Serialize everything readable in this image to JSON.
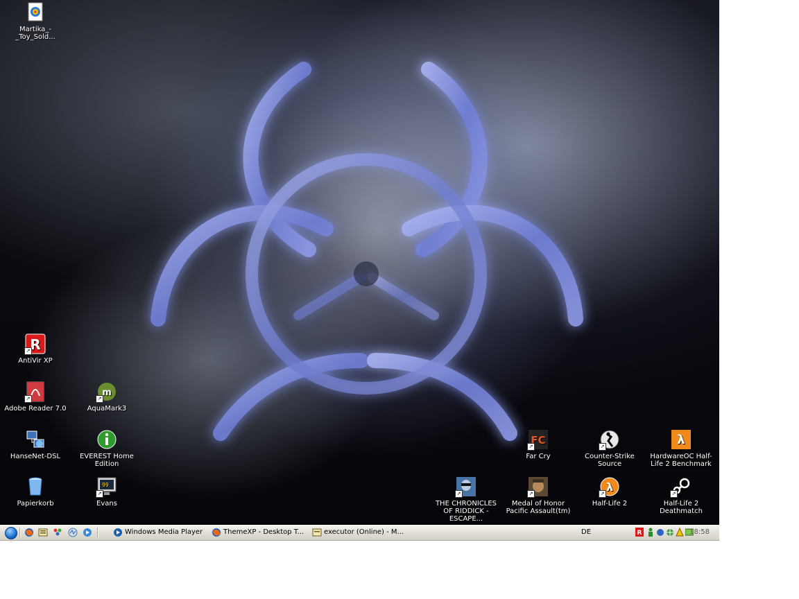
{
  "desktop_icons": [
    {
      "label": "Martika_-_Toy_Sold...",
      "icon": "media-file-icon"
    },
    {
      "label": "AntiVir XP",
      "icon": "antivir-icon"
    },
    {
      "label": "Adobe Reader 7.0",
      "icon": "adobe-reader-icon"
    },
    {
      "label": "AquaMark3",
      "icon": "aquamark-icon"
    },
    {
      "label": "HanseNet-DSL",
      "icon": "network-icon"
    },
    {
      "label": "EVEREST Home Edition",
      "icon": "info-icon"
    },
    {
      "label": "Papierkorb",
      "icon": "recycle-bin-icon"
    },
    {
      "label": "Evans",
      "icon": "monitor-icon"
    },
    {
      "label": "Far Cry",
      "icon": "far-cry-icon"
    },
    {
      "label": "Counter-Strike Source",
      "icon": "counter-strike-icon"
    },
    {
      "label": "HardwareOC Half-Life 2 Benchmark",
      "icon": "half-life-bench-icon"
    },
    {
      "label": "THE CHRONICLES OF RIDDICK - ESCAPE...",
      "icon": "riddick-icon"
    },
    {
      "label": "Medal of Honor Pacific Assault(tm)",
      "icon": "medal-of-honor-icon"
    },
    {
      "label": "Half-Life 2",
      "icon": "half-life-icon"
    },
    {
      "label": "Half-Life 2 Deathmatch",
      "icon": "steam-icon"
    }
  ],
  "taskbar": {
    "tasks": [
      {
        "label": "Windows Media Player",
        "icon": "media-player-icon"
      },
      {
        "label": "ThemeXP - Desktop T...",
        "icon": "firefox-icon"
      },
      {
        "label": "executor (Online) - M...",
        "icon": "chat-window-icon"
      }
    ],
    "language": "DE",
    "clock": "18:58"
  },
  "colors": {
    "biohazard": "#6f7fd6",
    "taskbar": "#e2e0d8",
    "start_orb": "#1a6fd0"
  }
}
